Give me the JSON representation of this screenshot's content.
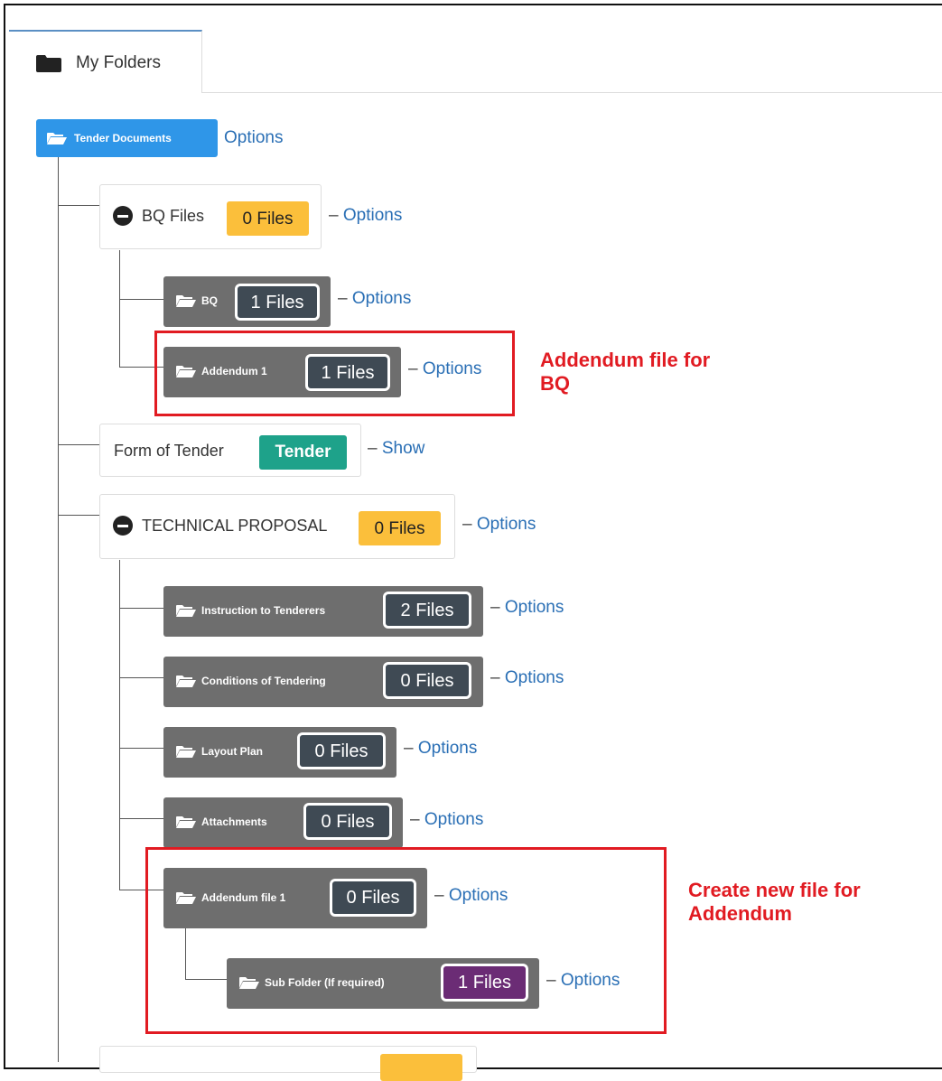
{
  "tab": {
    "label": "My Folders",
    "icon": "folder-icon"
  },
  "root": {
    "label": "Tender Documents",
    "options": "Options"
  },
  "dash": "–",
  "nodes": {
    "bq_files": {
      "label": "BQ Files",
      "badge": "0 Files",
      "link": "Options"
    },
    "bq": {
      "label": "BQ",
      "badge": "1 Files",
      "link": "Options"
    },
    "addendum1": {
      "label": "Addendum 1",
      "badge": "1 Files",
      "link": "Options"
    },
    "form_of_tender": {
      "label": "Form of Tender",
      "badge": "Tender",
      "link": "Show"
    },
    "technical": {
      "label": "TECHNICAL PROPOSAL",
      "badge": "0 Files",
      "link": "Options"
    },
    "instruction": {
      "label": "Instruction to Tenderers",
      "badge": "2 Files",
      "link": "Options"
    },
    "conditions": {
      "label": "Conditions of Tendering",
      "badge": "0 Files",
      "link": "Options"
    },
    "layout": {
      "label": "Layout Plan",
      "badge": "0 Files",
      "link": "Options"
    },
    "attachments": {
      "label": "Attachments",
      "badge": "0 Files",
      "link": "Options"
    },
    "addendum_file1": {
      "label": "Addendum file 1",
      "badge": "0 Files",
      "link": "Options"
    },
    "subfolder": {
      "label": "Sub Folder (If required)",
      "badge": "1 Files",
      "link": "Options"
    }
  },
  "annotations": {
    "a1_line1": "Addendum file for",
    "a1_line2": "BQ",
    "a2_line1": "Create new file for",
    "a2_line2": "Addendum"
  },
  "colors": {
    "primary": "#2f96e8",
    "warning": "#fbbf3b",
    "success": "#1ea28a",
    "folder_gray": "#6e6e6e",
    "count_dark": "#3f4a54",
    "purple": "#6b2c75",
    "annotation_red": "#e11b22"
  }
}
